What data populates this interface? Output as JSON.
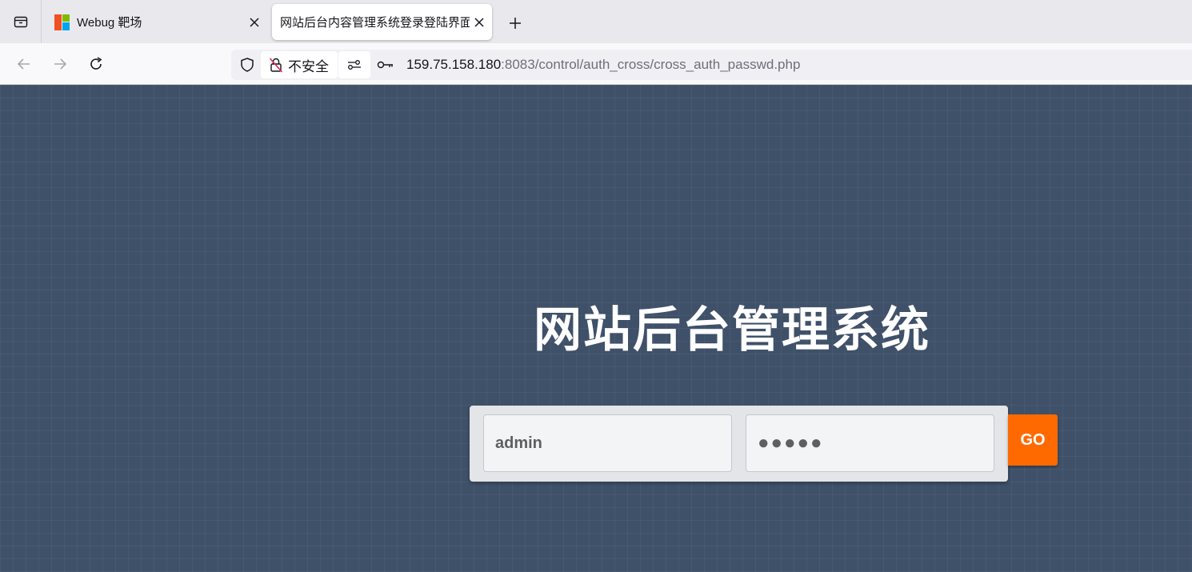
{
  "browser": {
    "tabs": [
      {
        "title": "Webug 靶场",
        "active": false
      },
      {
        "title": "网站后台内容管理系统登录登陆界面",
        "active": true
      }
    ],
    "security_label": "不安全",
    "url_host": "159.75.158.180",
    "url_rest": ":8083/control/auth_cross/cross_auth_passwd.php"
  },
  "page": {
    "heading": "网站后台管理系统",
    "username_value": "admin",
    "password_mask": "●●●●●",
    "go_label": "GO"
  },
  "colors": {
    "background": "#3f5069",
    "go_button": "#ff6a00",
    "login_box": "#e3e5e8"
  }
}
